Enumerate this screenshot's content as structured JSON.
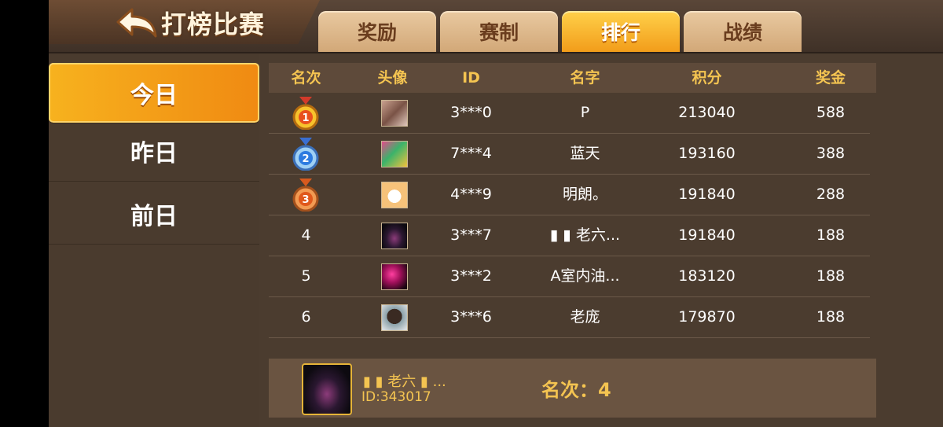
{
  "header": {
    "title": "打榜比赛",
    "tabs": [
      {
        "label": "奖励",
        "active": false
      },
      {
        "label": "赛制",
        "active": false
      },
      {
        "label": "排行",
        "active": true
      },
      {
        "label": "战绩",
        "active": false
      }
    ]
  },
  "sidebar": {
    "items": [
      {
        "label": "今日",
        "active": true
      },
      {
        "label": "昨日",
        "active": false
      },
      {
        "label": "前日",
        "active": false
      }
    ]
  },
  "table": {
    "headers": [
      "名次",
      "头像",
      "ID",
      "名字",
      "积分",
      "奖金"
    ],
    "rows": [
      {
        "rank": "1",
        "medal": "gold-medal-icon",
        "id": "3***0",
        "name": "P",
        "score": "213040",
        "prize": "588"
      },
      {
        "rank": "2",
        "medal": "silver-medal-icon",
        "id": "7***4",
        "name": "蓝天",
        "score": "193160",
        "prize": "388"
      },
      {
        "rank": "3",
        "medal": "bronze-medal-icon",
        "id": "4***9",
        "name": "明朗。",
        "score": "191840",
        "prize": "288"
      },
      {
        "rank": "4",
        "medal": null,
        "id": "3***7",
        "name": "▮ ▮ 老六...",
        "score": "191840",
        "prize": "188"
      },
      {
        "rank": "5",
        "medal": null,
        "id": "3***2",
        "name": "A室内油...",
        "score": "183120",
        "prize": "188"
      },
      {
        "rank": "6",
        "medal": null,
        "id": "3***6",
        "name": "老庞",
        "score": "179870",
        "prize": "188"
      }
    ]
  },
  "my_rank": {
    "name": "▮ ▮ 老六 ▮ ...",
    "id": "ID:343017",
    "rank_text": "名次：4"
  },
  "colors": {
    "accent": "#f4c451",
    "tab_active": "#f29d1a",
    "background": "#4b3c2f"
  }
}
